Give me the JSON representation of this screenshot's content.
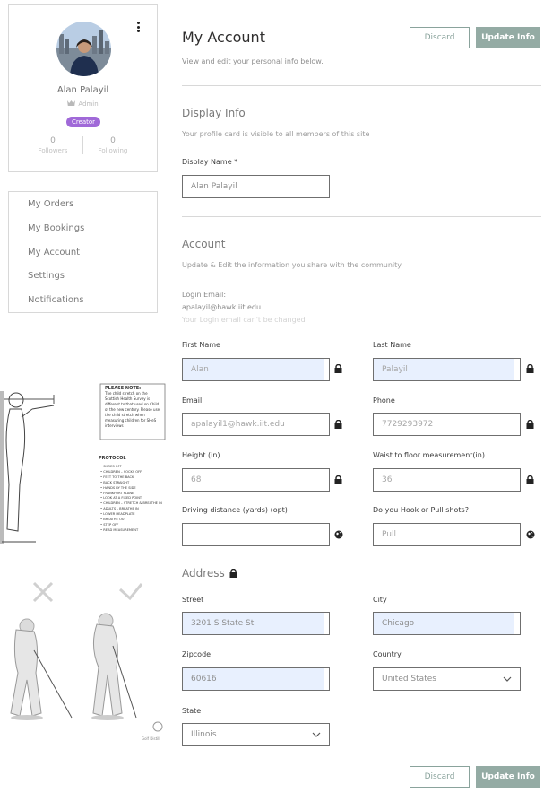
{
  "profile": {
    "name": "Alan Palayil",
    "role": "Admin",
    "badge": "Creator",
    "followers_count": "0",
    "followers_label": "Followers",
    "following_count": "0",
    "following_label": "Following"
  },
  "nav": {
    "items": [
      {
        "label": "My Orders"
      },
      {
        "label": "My Bookings"
      },
      {
        "label": "My Account"
      },
      {
        "label": "Settings"
      },
      {
        "label": "Notifications"
      }
    ]
  },
  "header": {
    "title": "My Account",
    "subtitle": "View and edit your personal info below.",
    "discard_label": "Discard",
    "update_label": "Update Info"
  },
  "display_info": {
    "title": "Display Info",
    "subtitle": "Your profile card is visible to all members of this site",
    "display_name_label": "Display Name *",
    "display_name_value": "Alan Palayil"
  },
  "account": {
    "title": "Account",
    "subtitle": "Update & Edit the information you share with the community",
    "login_email_label": "Login Email:",
    "login_email_value": "apalayil@hawk.iit.edu",
    "login_email_note": "Your Login email can't be changed",
    "first_name_label": "First Name",
    "first_name_value": "Alan",
    "last_name_label": "Last Name",
    "last_name_value": "Palayil",
    "email_label": "Email",
    "email_value": "apalayil1@hawk.iit.edu",
    "phone_label": "Phone",
    "phone_value": "7729293972",
    "height_label": "Height (in)",
    "height_value": "68",
    "waist_label": "Waist to floor measurement(in)",
    "waist_value": "36",
    "driving_label": "Driving distance (yards) (opt)",
    "driving_value": "",
    "hook_label": "Do you Hook or Pull shots?",
    "hook_value": "Pull"
  },
  "address": {
    "title": "Address",
    "street_label": "Street",
    "street_value": "3201 S State St",
    "city_label": "City",
    "city_value": "Chicago",
    "zip_label": "Zipcode",
    "zip_value": "60616",
    "country_label": "Country",
    "country_value": "United States",
    "state_label": "State",
    "state_value": "Illinois"
  },
  "footer": {
    "discard_label": "Discard",
    "update_label": "Update Info"
  },
  "posture_note": {
    "note_title": "PLEASE NOTE:",
    "note_text": "The child stretch on the Scottish Health Survey is different to that used on Child of the new century. Please use the child stretch when measuring children for SHeS interviews",
    "protocol_title": "PROTOCOL",
    "protocol_items": [
      "SHOES OFF",
      "CHILDREN – SOCKS OFF",
      "FEET TO THE BACK",
      "BACK STRAIGHT",
      "HANDS BY THE SIDE",
      "FRANKFORT PLANE",
      "LOOK AT A FIXED POINT",
      "CHILDREN – STRETCH & BREATHE IN",
      "ADULTS – BREATHE IN",
      "LOWER HEADPLATE",
      "BREATHE OUT",
      "STEP OFF",
      "READ MEASUREMENT"
    ]
  },
  "golf_image": {
    "brand": "Golf Distill"
  },
  "icons": {
    "kebab": "more-vertical-icon",
    "crown": "crown-icon",
    "lock": "lock-icon",
    "globe": "globe-icon",
    "chevron": "chevron-down-icon",
    "wrong": "cross-icon",
    "right": "check-icon"
  },
  "colors": {
    "accent": "#94aba4",
    "badge": "#a069d8",
    "autofill": "#e8f0fe"
  }
}
